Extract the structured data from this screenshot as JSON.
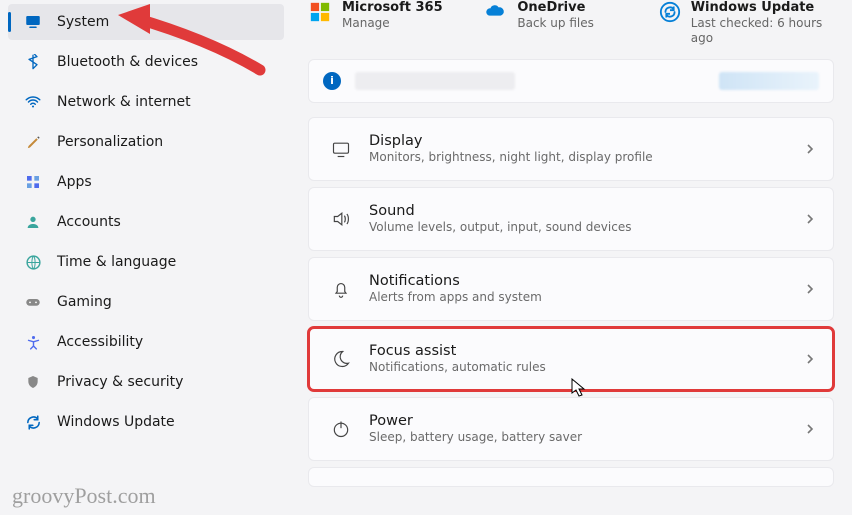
{
  "sidebar": {
    "items": [
      {
        "label": "System",
        "icon": "monitor-icon",
        "active": true
      },
      {
        "label": "Bluetooth & devices",
        "icon": "bluetooth-icon",
        "active": false
      },
      {
        "label": "Network & internet",
        "icon": "wifi-icon",
        "active": false
      },
      {
        "label": "Personalization",
        "icon": "brush-icon",
        "active": false
      },
      {
        "label": "Apps",
        "icon": "apps-icon",
        "active": false
      },
      {
        "label": "Accounts",
        "icon": "person-icon",
        "active": false
      },
      {
        "label": "Time & language",
        "icon": "globe-icon",
        "active": false
      },
      {
        "label": "Gaming",
        "icon": "gamepad-icon",
        "active": false
      },
      {
        "label": "Accessibility",
        "icon": "accessibility-icon",
        "active": false
      },
      {
        "label": "Privacy & security",
        "icon": "shield-icon",
        "active": false
      },
      {
        "label": "Windows Update",
        "icon": "update-icon",
        "active": false
      }
    ]
  },
  "quick": {
    "ms365": {
      "title": "Microsoft 365",
      "sub": "Manage"
    },
    "onedrive": {
      "title": "OneDrive",
      "sub": "Back up files"
    },
    "update": {
      "title": "Windows Update",
      "sub": "Last checked: 6 hours ago"
    }
  },
  "cards": [
    {
      "title": "Display",
      "sub": "Monitors, brightness, night light, display profile",
      "icon": "display"
    },
    {
      "title": "Sound",
      "sub": "Volume levels, output, input, sound devices",
      "icon": "sound"
    },
    {
      "title": "Notifications",
      "sub": "Alerts from apps and system",
      "icon": "bell"
    },
    {
      "title": "Focus assist",
      "sub": "Notifications, automatic rules",
      "icon": "moon",
      "highlight": true
    },
    {
      "title": "Power",
      "sub": "Sleep, battery usage, battery saver",
      "icon": "power"
    }
  ],
  "watermark": "groovyPost.com"
}
